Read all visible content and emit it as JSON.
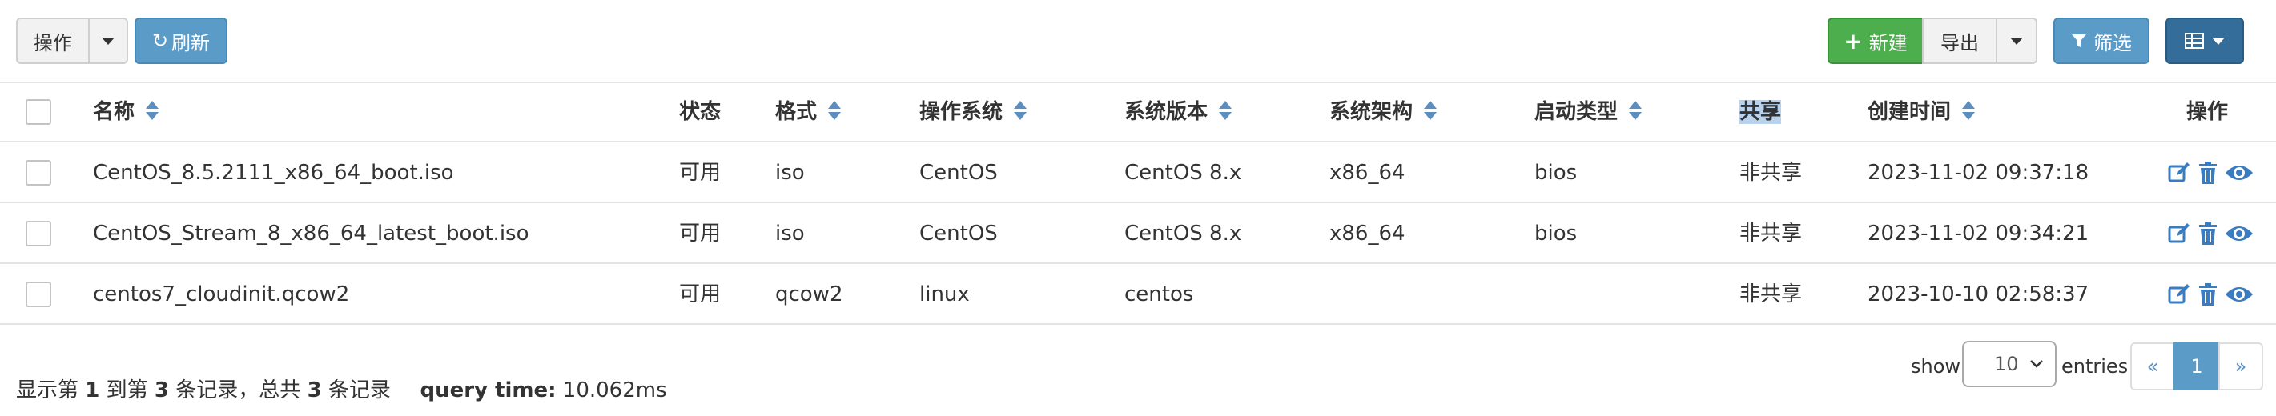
{
  "toolbar": {
    "action_label": "操作",
    "refresh_label": "刷新",
    "new_label": "新建",
    "export_label": "导出",
    "filter_label": "筛选"
  },
  "table": {
    "headers": [
      "名称",
      "状态",
      "格式",
      "操作系统",
      "系统版本",
      "系统架构",
      "启动类型",
      "共享",
      "创建时间",
      "操作"
    ],
    "rows": [
      {
        "name": "CentOS_8.5.2111_x86_64_boot.iso",
        "status": "可用",
        "format": "iso",
        "os": "CentOS",
        "version": "CentOS 8.x",
        "arch": "x86_64",
        "boot": "bios",
        "share": "非共享",
        "created": "2023-11-02 09:37:18"
      },
      {
        "name": "CentOS_Stream_8_x86_64_latest_boot.iso",
        "status": "可用",
        "format": "iso",
        "os": "CentOS",
        "version": "CentOS 8.x",
        "arch": "x86_64",
        "boot": "bios",
        "share": "非共享",
        "created": "2023-11-02 09:34:21"
      },
      {
        "name": "centos7_cloudinit.qcow2",
        "status": "可用",
        "format": "qcow2",
        "os": "linux",
        "version": "centos",
        "arch": "",
        "boot": "",
        "share": "非共享",
        "created": "2023-10-10 02:58:37"
      }
    ]
  },
  "footer": {
    "summary_prefix": "显示第",
    "from": "1",
    "summary_mid1": "到第",
    "to": "3",
    "summary_mid2": "条记录，总共",
    "total": "3",
    "summary_suffix": "条记录",
    "query_label": "query time:",
    "query_value": "10.062ms",
    "show_label": "show",
    "page_size": "10",
    "entries_label": "entries",
    "prev": "«",
    "current_page": "1",
    "next": "»"
  },
  "colors": {
    "accent_blue": "#5b9bc8",
    "success_green": "#4cae4c",
    "primary_dark": "#346d99",
    "highlight": "#b9d3ee"
  }
}
